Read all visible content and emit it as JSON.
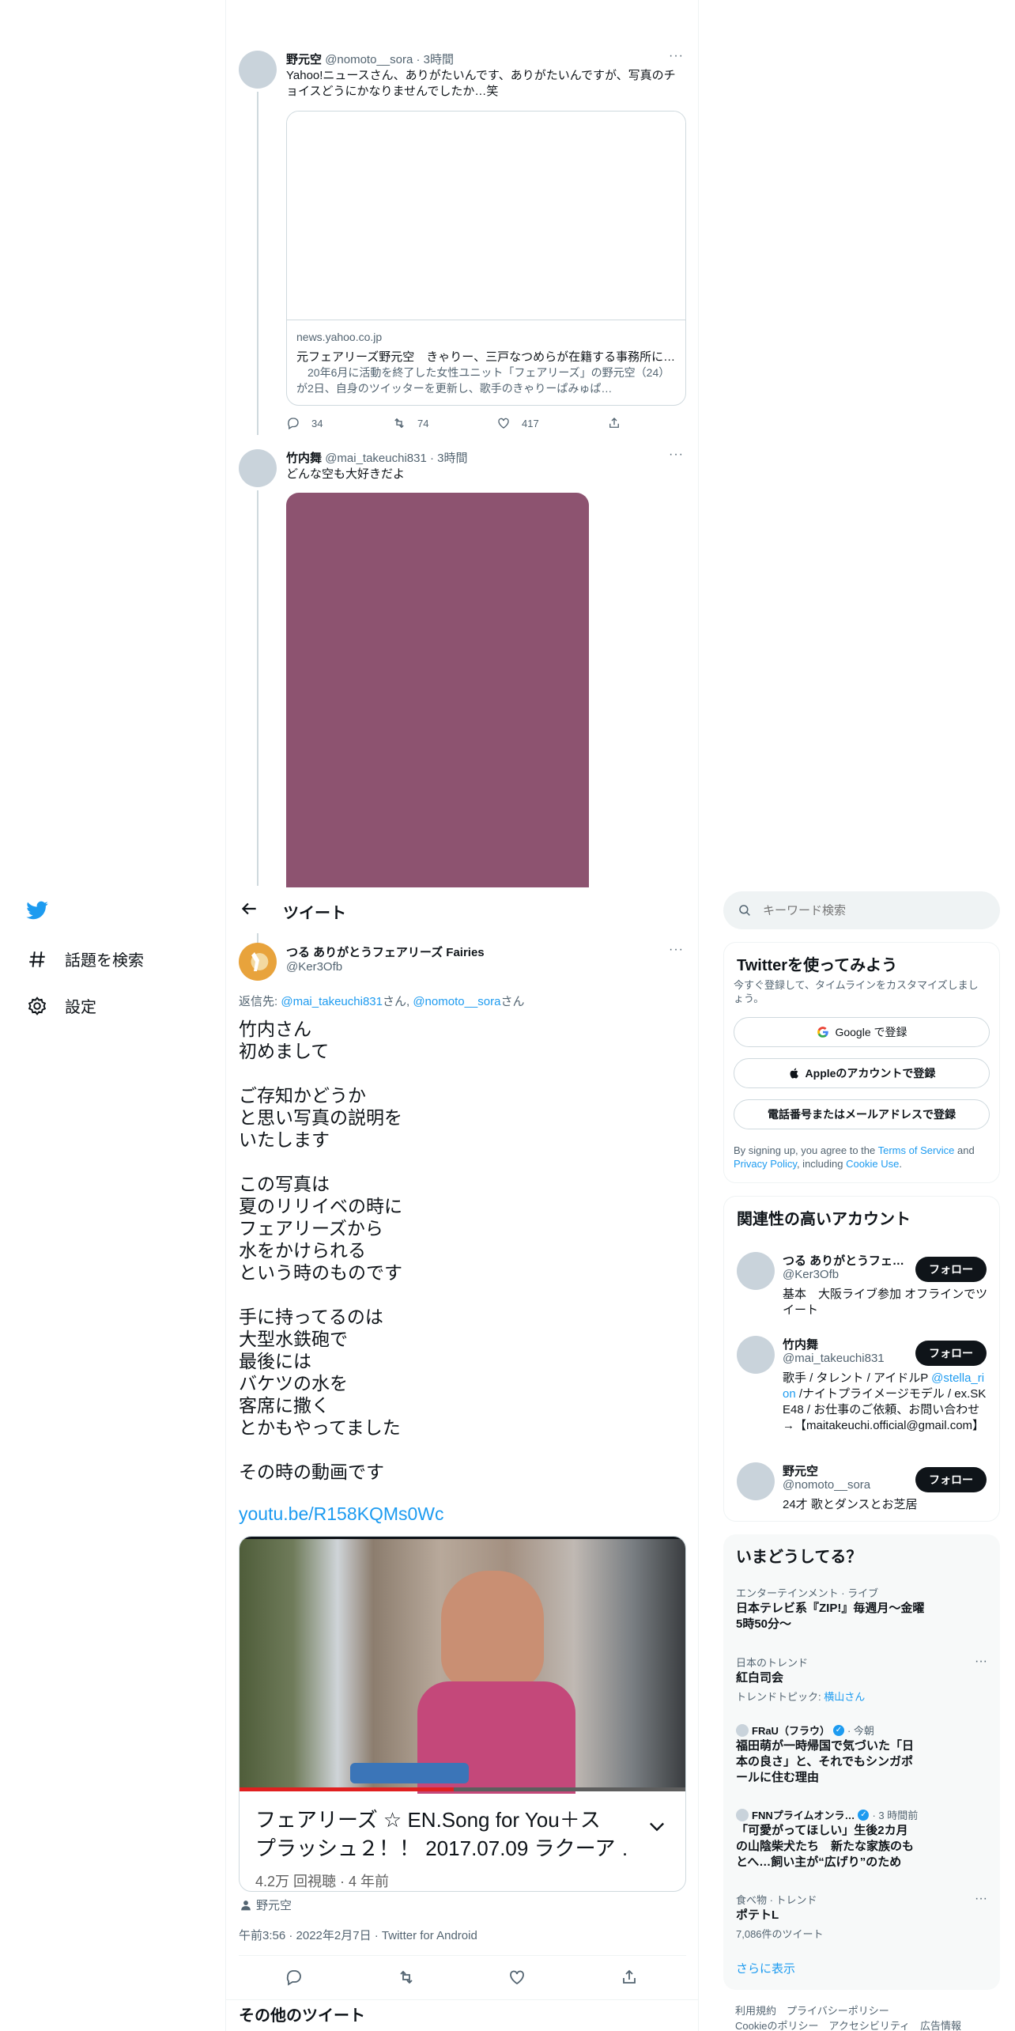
{
  "side_nav": {
    "explore_label": "話題を検索",
    "settings_label": "設定"
  },
  "thread_tweets": [
    {
      "name": "野元空",
      "meta": "@nomoto__sora · 3時間",
      "text": "Yahoo!ニュースさん、ありがたいんです、ありがたいんですが、写真のチョイスどうにかなりませんでしたか…笑",
      "card_domain": "news.yahoo.co.jp",
      "card_title": "元フェアリーズ野元空　きゃりー、三戸なつめらが在籍する事務所に…",
      "card_desc": "　20年6月に活動を終了した女性ユニット「フェアリーズ」の野元空（24）が2日、自身のツイッターを更新し、歌手のきゃりーぱみゅぱ…",
      "replies": "34",
      "retweets": "74",
      "likes": "417"
    },
    {
      "name": "竹内舞",
      "meta": "@mai_takeuchi831 · 3時間",
      "text": "どんな空も大好きだよ",
      "image_color": "#8d5370"
    }
  ],
  "header": {
    "title": "ツイート"
  },
  "main_tweet": {
    "name": "つる ありがとうフェアリーズ Fairies",
    "handle": "@Ker3Ofb",
    "reply_prefix": "返信先: ",
    "reply_to_1": "@mai_takeuchi831",
    "reply_mid": "さん, ",
    "reply_to_2": "@nomoto__sora",
    "reply_suffix": "さん",
    "body": "竹内さん\n初めまして\n\nご存知かどうか\nと思い写真の説明を\nいたします\n\nこの写真は\n夏のリリイベの時に\nフェアリーズから\n水をかけられる\nという時のものです\n\n手に持ってるのは\n大型水鉄砲で\n最後には\nバケツの水を\n客席に撒く\nとかもやってました\n\nその時の動画です",
    "link": "youtu.be/R158KQMs0Wc",
    "video_title_1": "フェアリーズ ☆ EN.Song for You＋ス",
    "video_title_2": "プラッシュ２！！ 2017.07.09 ラクーア …",
    "video_meta": "4.2万 回視聴 · 4 年前",
    "tagged": "野元空",
    "timestamp": "午前3:56 · 2022年2月7日 · Twitter for Android",
    "more_tweets": "その他のツイート"
  },
  "search": {
    "placeholder": "キーワード検索"
  },
  "signup": {
    "title": "Twitterを使ってみよう",
    "subtitle": "今すぐ登録して、タイムラインをカスタマイズしましょう。",
    "google_label": "Google で登録",
    "apple_label": "Appleのアカウントで登録",
    "phone_label": "電話番号またはメールアドレスで登録",
    "terms_1": "By signing up, you agree to the ",
    "terms_link_1": "Terms of Service",
    "terms_2": " and ",
    "terms_link_2": "Privacy Policy",
    "terms_3": ", including ",
    "terms_link_3": "Cookie Use",
    "terms_4": "."
  },
  "related": {
    "title": "関連性の高いアカウント",
    "follow_label": "フォロー",
    "accounts": [
      {
        "name": "つる ありがとうフェ…",
        "handle": "@Ker3Ofb",
        "bio": "基本　大阪ライブ参加 オフラインでツイート"
      },
      {
        "name": "竹内舞",
        "handle": "@mai_takeuchi831",
        "bio_1": "歌手 / タレント / アイドルP ",
        "bio_link": "@stella_rion",
        "bio_2": " /ナイトプライメージモデル / ex.SKE48 / お仕事のご依頼、お問い合わせ→【maitakeuchi.official@gmail.com】"
      },
      {
        "name": "野元空",
        "handle": "@nomoto__sora",
        "bio": "24才 歌とダンスとお芝居"
      }
    ]
  },
  "trends": {
    "title": "いまどうしてる？",
    "items": [
      {
        "category": "エンターテインメント · ライブ",
        "title": "日本テレビ系『ZIP!』毎週月〜金曜 5時50分〜"
      },
      {
        "category": "日本のトレンド",
        "title": "紅白司会",
        "sub_prefix": "トレンドトピック: ",
        "sub_link": "横山さん"
      },
      {
        "category_name": "FRaU（フラウ）",
        "category_time": " · 今朝",
        "title": "福田萌が一時帰国で気づいた「日本の良さ」と、それでもシンガポールに住む理由"
      },
      {
        "category_name": "FNNプライムオンラ…",
        "category_time": " · 3 時間前",
        "title": "「可愛がってほしい」生後2カ月の山陰柴犬たち　新たな家族のもとへ…飼い主が“広げり”のため"
      },
      {
        "category": "食べ物 · トレンド",
        "title": "ポテトL",
        "sub": "7,086件のツイート"
      }
    ],
    "show_more": "さらに表示"
  },
  "footer": {
    "line1": "利用規約　プライバシーポリシー",
    "line2": "Cookieのポリシー　アクセシビリティ　広告情報"
  },
  "colors": {
    "accent": "#1d9bf0",
    "text": "#0f1419",
    "muted": "#536471",
    "panel_bg": "#f7f9f9"
  }
}
